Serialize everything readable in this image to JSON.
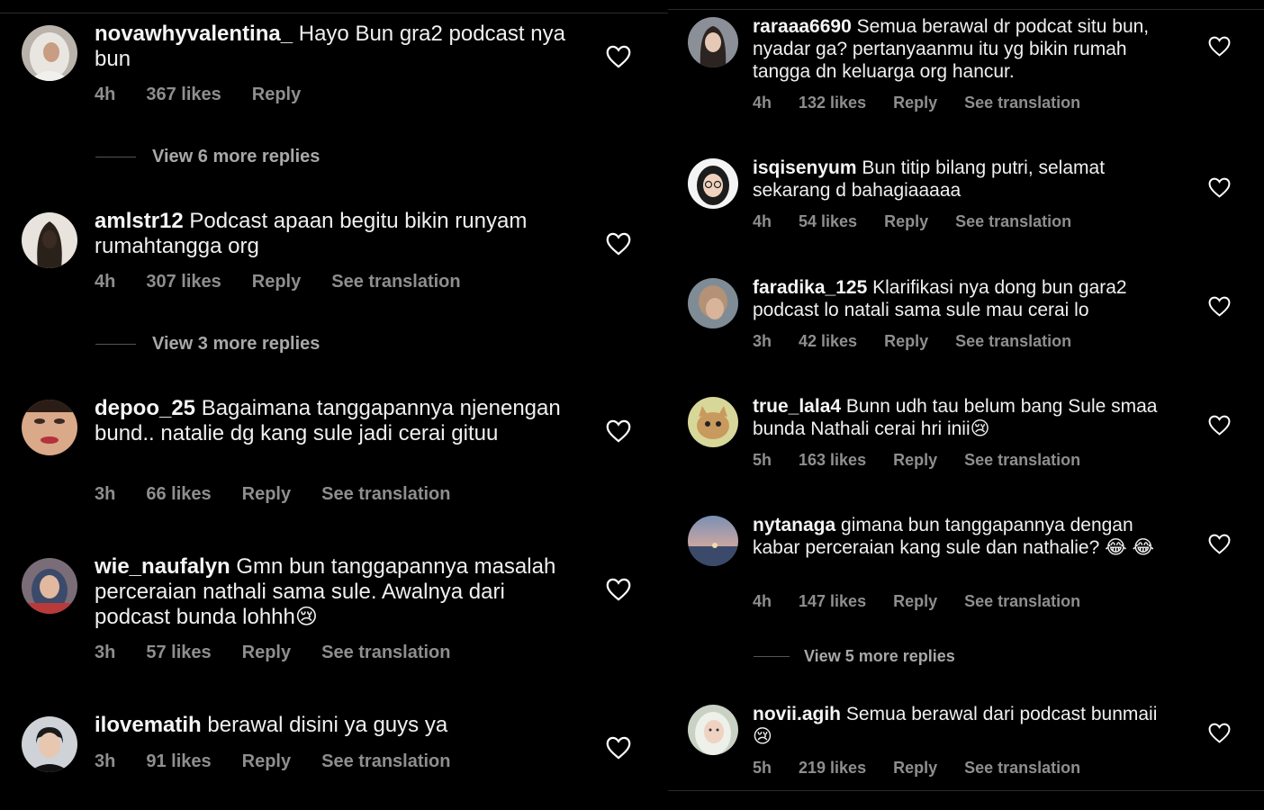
{
  "left": {
    "comments": [
      {
        "username": "novawhyvalentina_",
        "text": " Hayo Bun gra2 podcast nya bun",
        "time": "4h",
        "likes": "367 likes",
        "reply": "Reply",
        "translate": "",
        "avatar_icon": "hijab-woman-avatar"
      },
      {
        "username": "amlstr12",
        "text": " Podcast apaan begitu bikin runyam rumahtangga org",
        "time": "4h",
        "likes": "307 likes",
        "reply": "Reply",
        "translate": "See translation",
        "avatar_icon": "dark-hair-avatar"
      },
      {
        "username": "depoo_25",
        "text": " Bagaimana tanggapannya njenengan bund.. natalie dg kang sule jadi cerai gituu",
        "time": "3h",
        "likes": "66 likes",
        "reply": "Reply",
        "translate": "See translation",
        "avatar_icon": "face-closeup-avatar"
      },
      {
        "username": "wie_naufalyn",
        "text": " Gmn bun tanggapannya masalah perceraian nathali sama sule. Awalnya dari podcast bunda lohhh😢",
        "time": "3h",
        "likes": "57 likes",
        "reply": "Reply",
        "translate": "See translation",
        "avatar_icon": "hijab-selfie-avatar"
      },
      {
        "username": "ilovematih",
        "text": " berawal disini ya guys ya",
        "time": "3h",
        "likes": "91 likes",
        "reply": "Reply",
        "translate": "See translation",
        "avatar_icon": "man-portrait-avatar"
      }
    ],
    "more_replies": [
      "View 6 more replies",
      "View 3 more replies"
    ]
  },
  "right": {
    "comments": [
      {
        "username": "raraaa6690",
        "text": " Semua berawal dr podcat situ bun, nyadar ga? pertanyaanmu itu yg bikin rumah tangga dn keluarga org hancur.",
        "time": "4h",
        "likes": "132 likes",
        "reply": "Reply",
        "translate": "See translation",
        "avatar_icon": "long-hair-avatar"
      },
      {
        "username": "isqisenyum",
        "text": " Bun titip bilang putri, selamat sekarang d bahagiaaaaa",
        "time": "4h",
        "likes": "54 likes",
        "reply": "Reply",
        "translate": "See translation",
        "avatar_icon": "cartoon-hijab-avatar"
      },
      {
        "username": "faradika_125",
        "text": " Klarifikasi nya dong bun gara2 podcast lo natali sama sule mau cerai lo",
        "time": "3h",
        "likes": "42 likes",
        "reply": "Reply",
        "translate": "See translation",
        "avatar_icon": "short-hair-avatar"
      },
      {
        "username": "true_lala4",
        "text": " Bunn udh tau belum bang Sule smaa bunda Nathali cerai hri inii😢",
        "time": "5h",
        "likes": "163 likes",
        "reply": "Reply",
        "translate": "See translation",
        "avatar_icon": "cat-avatar"
      },
      {
        "username": "nytanaga",
        "text": " gimana bun tanggapannya dengan kabar perceraian kang sule dan nathalie? 😂 😂",
        "time": "4h",
        "likes": "147 likes",
        "reply": "Reply",
        "translate": "See translation",
        "avatar_icon": "sunset-avatar"
      },
      {
        "username": "novii.agih",
        "text": " Semua berawal dari podcast bunmaii😢",
        "time": "5h",
        "likes": "219 likes",
        "reply": "Reply",
        "translate": "See translation",
        "avatar_icon": "hijab-girl-avatar"
      }
    ],
    "more_replies": [
      "View 5 more replies"
    ]
  },
  "colors": {
    "background": "#000000",
    "text": "#f5f5f5",
    "meta": "#8e8e8e",
    "heart": "#ffffff"
  }
}
